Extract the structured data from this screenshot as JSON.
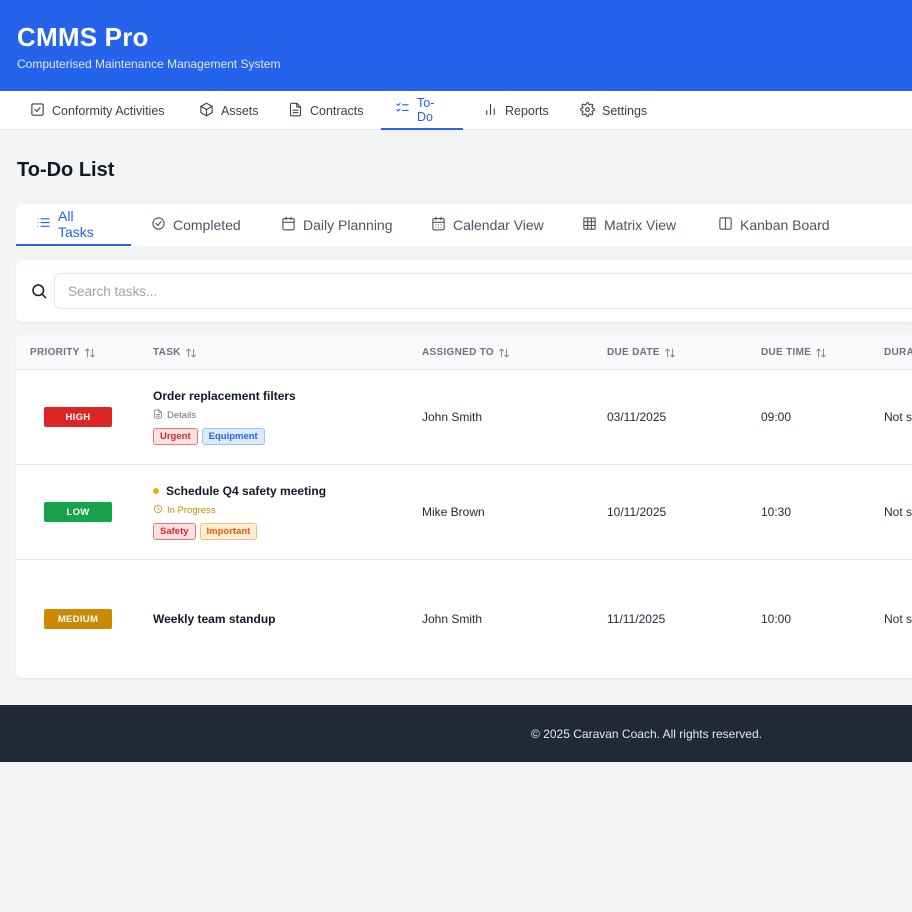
{
  "app": {
    "title": "CMMS Pro",
    "subtitle": "Computerised Maintenance Management System",
    "brand_color": "#2563eb"
  },
  "nav": {
    "items": [
      {
        "label": "Conformity Activities",
        "icon": "checkbox-icon"
      },
      {
        "label": "Assets",
        "icon": "cube-icon"
      },
      {
        "label": "Contracts",
        "icon": "document-icon"
      },
      {
        "label": "To-Do",
        "icon": "checklist-icon",
        "active": true
      },
      {
        "label": "Reports",
        "icon": "bar-chart-icon"
      },
      {
        "label": "Settings",
        "icon": "gear-icon"
      }
    ]
  },
  "page": {
    "title": "To-Do List"
  },
  "subtabs": {
    "items": [
      {
        "label": "All Tasks",
        "icon": "list-icon",
        "active": true
      },
      {
        "label": "Completed",
        "icon": "check-circle-icon"
      },
      {
        "label": "Daily Planning",
        "icon": "calendar-icon"
      },
      {
        "label": "Calendar View",
        "icon": "calendar-grid-icon"
      },
      {
        "label": "Matrix View",
        "icon": "grid-icon"
      },
      {
        "label": "Kanban Board",
        "icon": "columns-icon"
      }
    ]
  },
  "search": {
    "placeholder": "Search tasks...",
    "value": ""
  },
  "table": {
    "headers": {
      "priority": "PRIORITY",
      "task": "TASK",
      "assigned_to": "ASSIGNED TO",
      "due_date": "DUE DATE",
      "due_time": "DUE TIME",
      "duration": "DURATION"
    },
    "rows": [
      {
        "priority": "HIGH",
        "priority_color": "#dc2626",
        "task": "Order replacement filters",
        "meta": "Details",
        "meta_icon": "document-icon",
        "tags": [
          {
            "label": "Urgent",
            "style": "red"
          },
          {
            "label": "Equipment",
            "style": "blue"
          }
        ],
        "assigned_to": "John Smith",
        "due_date": "03/11/2025",
        "due_time": "09:00",
        "duration": "Not set"
      },
      {
        "priority": "LOW",
        "priority_color": "#16a34a",
        "task": "Schedule Q4 safety meeting",
        "status_dot_color": "#eab308",
        "meta": "In Progress",
        "meta_icon": "clock-icon",
        "meta_color": "#ca8a04",
        "tags": [
          {
            "label": "Safety",
            "style": "red"
          },
          {
            "label": "Important",
            "style": "orange"
          }
        ],
        "assigned_to": "Mike Brown",
        "due_date": "10/11/2025",
        "due_time": "10:30",
        "duration": "Not set"
      },
      {
        "priority": "MEDIUM",
        "priority_color": "#ca8a04",
        "task": "Weekly team standup",
        "assigned_to": "John Smith",
        "due_date": "11/11/2025",
        "due_time": "10:00",
        "duration": "Not set"
      }
    ]
  },
  "footer": {
    "text": "© 2025 Caravan Coach. All rights reserved."
  }
}
